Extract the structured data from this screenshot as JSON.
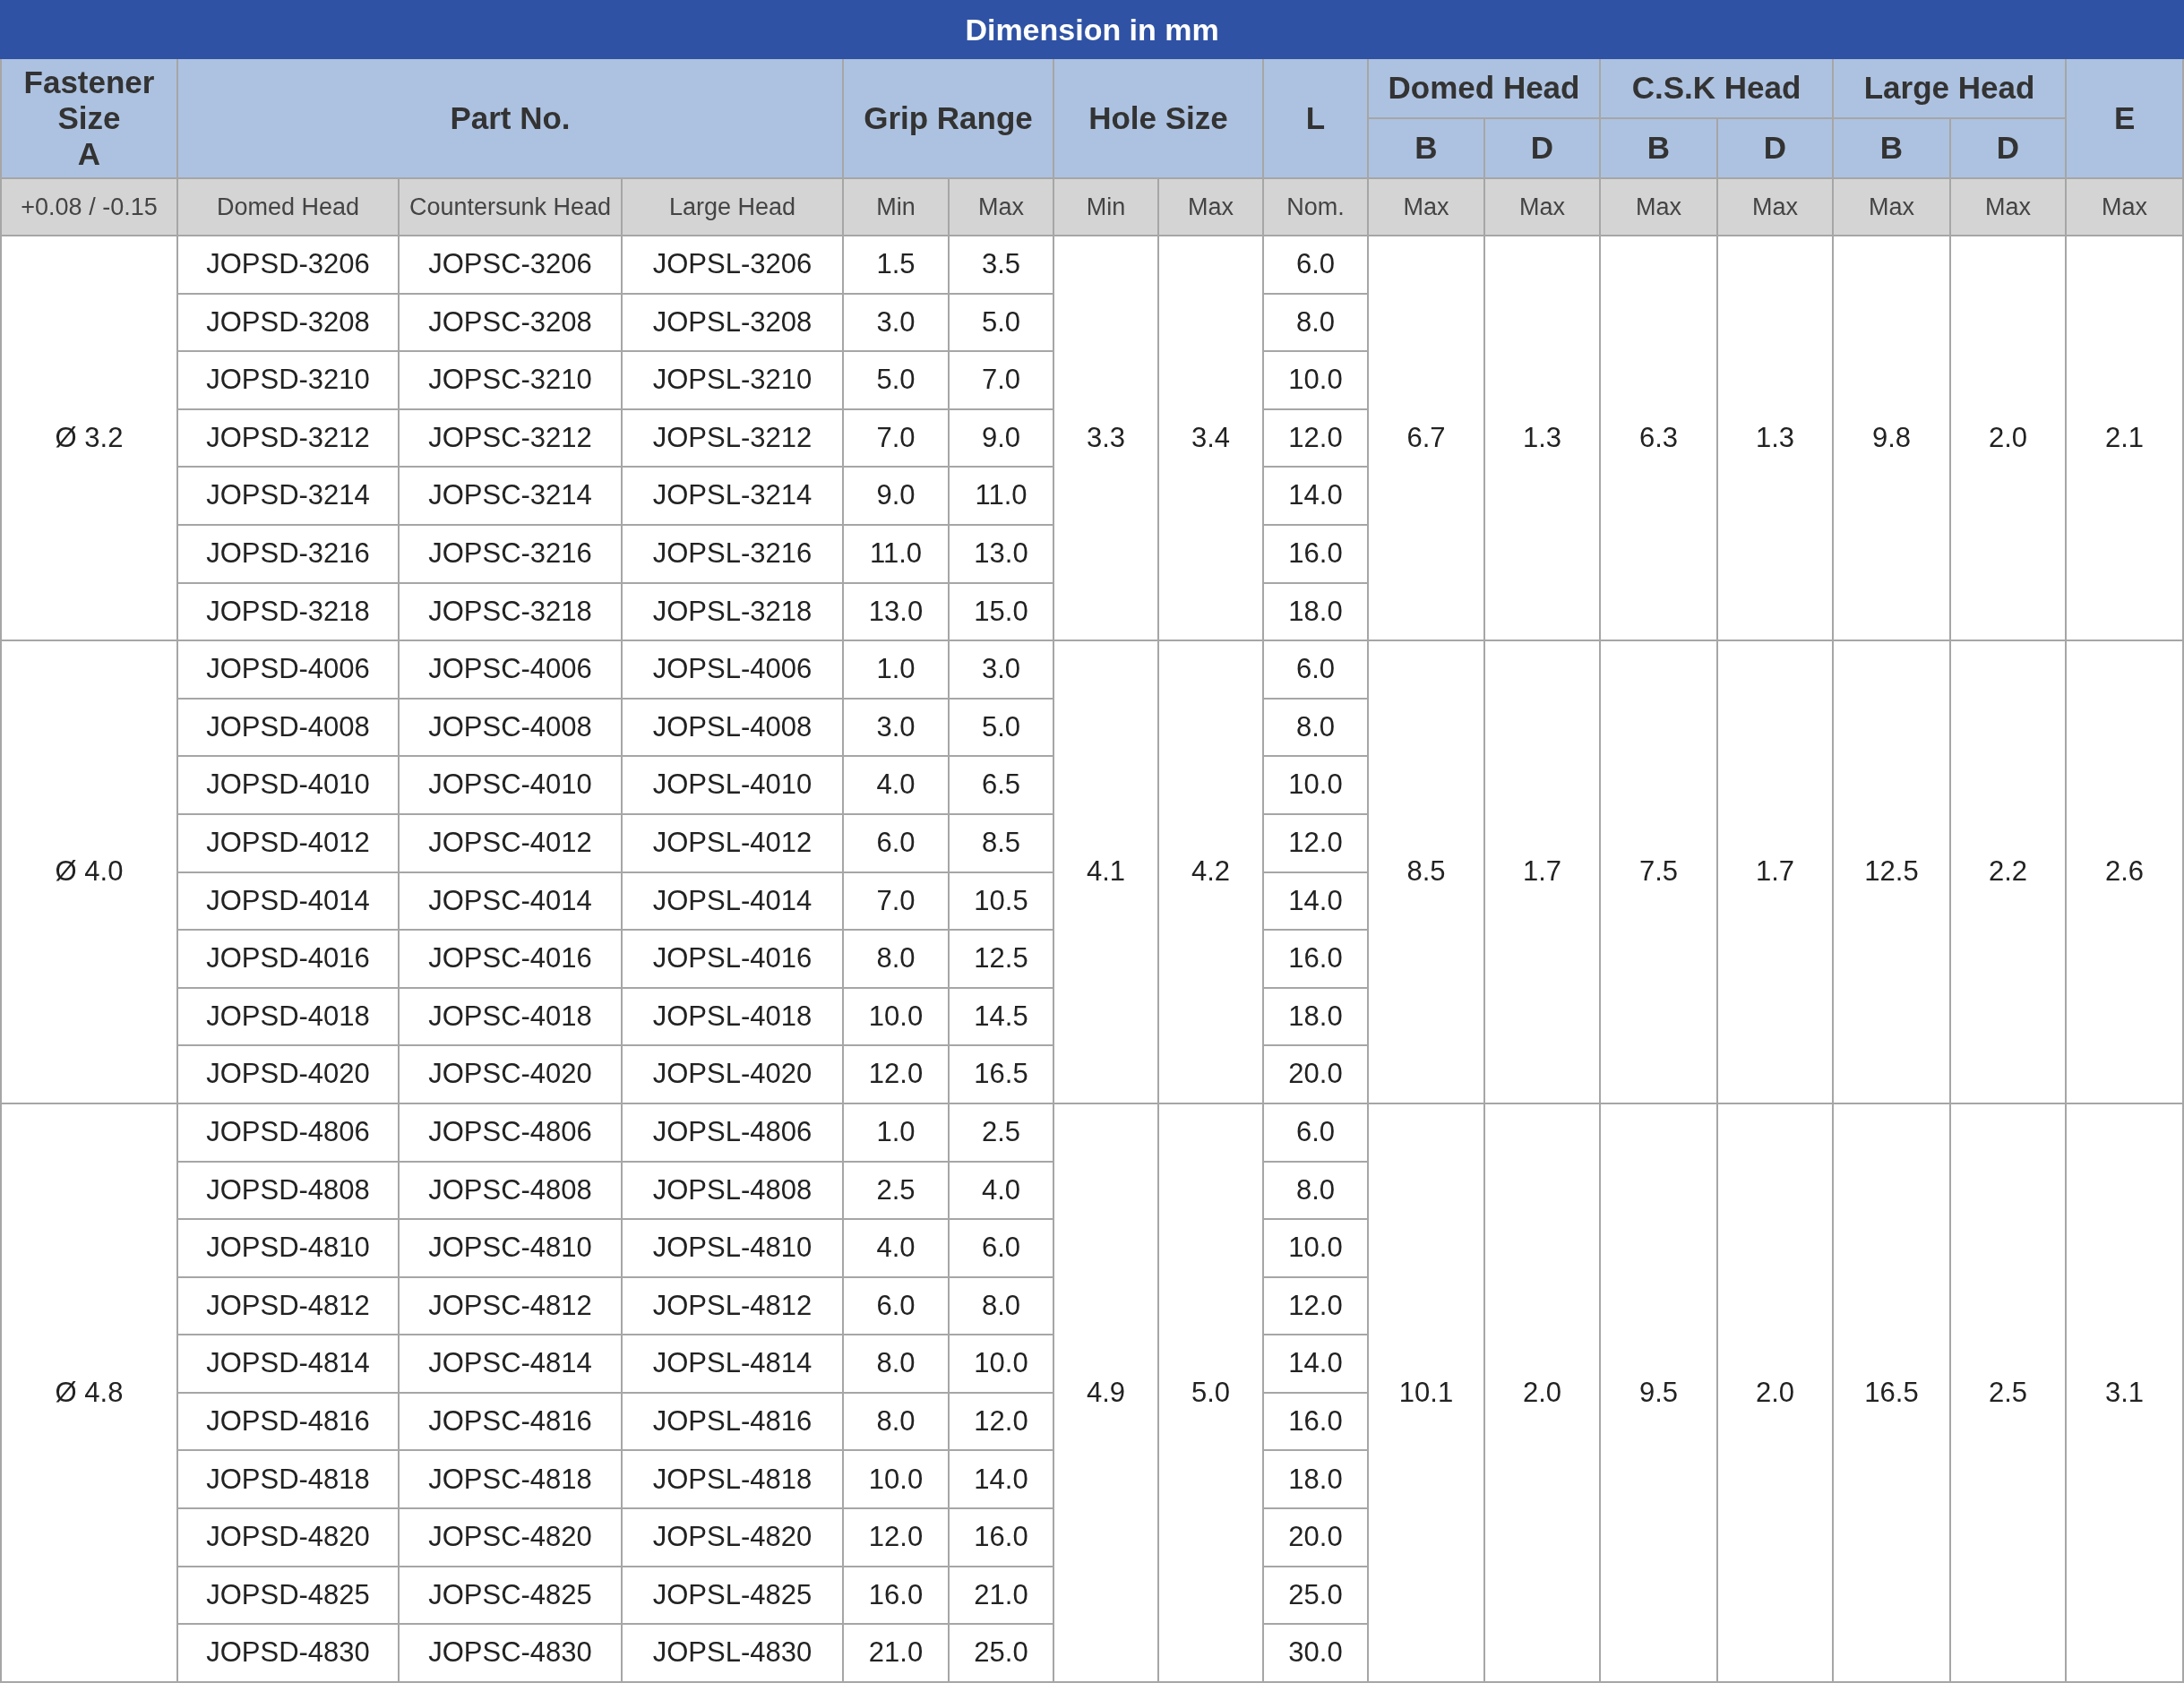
{
  "title": "Dimension in mm",
  "header": {
    "fastener": {
      "label": "Fastener Size",
      "sub": "A"
    },
    "part_no": "Part No.",
    "grip_range": "Grip Range",
    "hole_size": "Hole Size",
    "l": "L",
    "domed_head": "Domed Head",
    "csk_head": "C.S.K Head",
    "large_head": "Large Head",
    "e": "E",
    "b_d": [
      "B",
      "D",
      "B",
      "D",
      "B",
      "D"
    ]
  },
  "subheader": [
    "+0.08 / -0.15",
    "Domed Head",
    "Countersunk Head",
    "Large Head",
    "Min",
    "Max",
    "Min",
    "Max",
    "Nom.",
    "Max",
    "Max",
    "Max",
    "Max",
    "Max",
    "Max",
    "Max"
  ],
  "groups": [
    {
      "size": "Ø 3.2",
      "hole_min": "3.3",
      "hole_max": "3.4",
      "domed_b": "6.7",
      "domed_d": "1.3",
      "csk_b": "6.3",
      "csk_d": "1.3",
      "large_b": "9.8",
      "large_d": "2.0",
      "e": "2.1",
      "rows": [
        [
          "JOPSD-3206",
          "JOPSC-3206",
          "JOPSL-3206",
          "1.5",
          "3.5",
          "6.0"
        ],
        [
          "JOPSD-3208",
          "JOPSC-3208",
          "JOPSL-3208",
          "3.0",
          "5.0",
          "8.0"
        ],
        [
          "JOPSD-3210",
          "JOPSC-3210",
          "JOPSL-3210",
          "5.0",
          "7.0",
          "10.0"
        ],
        [
          "JOPSD-3212",
          "JOPSC-3212",
          "JOPSL-3212",
          "7.0",
          "9.0",
          "12.0"
        ],
        [
          "JOPSD-3214",
          "JOPSC-3214",
          "JOPSL-3214",
          "9.0",
          "11.0",
          "14.0"
        ],
        [
          "JOPSD-3216",
          "JOPSC-3216",
          "JOPSL-3216",
          "11.0",
          "13.0",
          "16.0"
        ],
        [
          "JOPSD-3218",
          "JOPSC-3218",
          "JOPSL-3218",
          "13.0",
          "15.0",
          "18.0"
        ]
      ]
    },
    {
      "size": "Ø 4.0",
      "hole_min": "4.1",
      "hole_max": "4.2",
      "domed_b": "8.5",
      "domed_d": "1.7",
      "csk_b": "7.5",
      "csk_d": "1.7",
      "large_b": "12.5",
      "large_d": "2.2",
      "e": "2.6",
      "rows": [
        [
          "JOPSD-4006",
          "JOPSC-4006",
          "JOPSL-4006",
          "1.0",
          "3.0",
          "6.0"
        ],
        [
          "JOPSD-4008",
          "JOPSC-4008",
          "JOPSL-4008",
          "3.0",
          "5.0",
          "8.0"
        ],
        [
          "JOPSD-4010",
          "JOPSC-4010",
          "JOPSL-4010",
          "4.0",
          "6.5",
          "10.0"
        ],
        [
          "JOPSD-4012",
          "JOPSC-4012",
          "JOPSL-4012",
          "6.0",
          "8.5",
          "12.0"
        ],
        [
          "JOPSD-4014",
          "JOPSC-4014",
          "JOPSL-4014",
          "7.0",
          "10.5",
          "14.0"
        ],
        [
          "JOPSD-4016",
          "JOPSC-4016",
          "JOPSL-4016",
          "8.0",
          "12.5",
          "16.0"
        ],
        [
          "JOPSD-4018",
          "JOPSC-4018",
          "JOPSL-4018",
          "10.0",
          "14.5",
          "18.0"
        ],
        [
          "JOPSD-4020",
          "JOPSC-4020",
          "JOPSL-4020",
          "12.0",
          "16.5",
          "20.0"
        ]
      ]
    },
    {
      "size": "Ø 4.8",
      "hole_min": "4.9",
      "hole_max": "5.0",
      "domed_b": "10.1",
      "domed_d": "2.0",
      "csk_b": "9.5",
      "csk_d": "2.0",
      "large_b": "16.5",
      "large_d": "2.5",
      "e": "3.1",
      "rows": [
        [
          "JOPSD-4806",
          "JOPSC-4806",
          "JOPSL-4806",
          "1.0",
          "2.5",
          "6.0"
        ],
        [
          "JOPSD-4808",
          "JOPSC-4808",
          "JOPSL-4808",
          "2.5",
          "4.0",
          "8.0"
        ],
        [
          "JOPSD-4810",
          "JOPSC-4810",
          "JOPSL-4810",
          "4.0",
          "6.0",
          "10.0"
        ],
        [
          "JOPSD-4812",
          "JOPSC-4812",
          "JOPSL-4812",
          "6.0",
          "8.0",
          "12.0"
        ],
        [
          "JOPSD-4814",
          "JOPSC-4814",
          "JOPSL-4814",
          "8.0",
          "10.0",
          "14.0"
        ],
        [
          "JOPSD-4816",
          "JOPSC-4816",
          "JOPSL-4816",
          "8.0",
          "12.0",
          "16.0"
        ],
        [
          "JOPSD-4818",
          "JOPSC-4818",
          "JOPSL-4818",
          "10.0",
          "14.0",
          "18.0"
        ],
        [
          "JOPSD-4820",
          "JOPSC-4820",
          "JOPSL-4820",
          "12.0",
          "16.0",
          "20.0"
        ],
        [
          "JOPSD-4825",
          "JOPSC-4825",
          "JOPSL-4825",
          "16.0",
          "21.0",
          "25.0"
        ],
        [
          "JOPSD-4830",
          "JOPSC-4830",
          "JOPSL-4830",
          "21.0",
          "25.0",
          "30.0"
        ]
      ]
    }
  ]
}
